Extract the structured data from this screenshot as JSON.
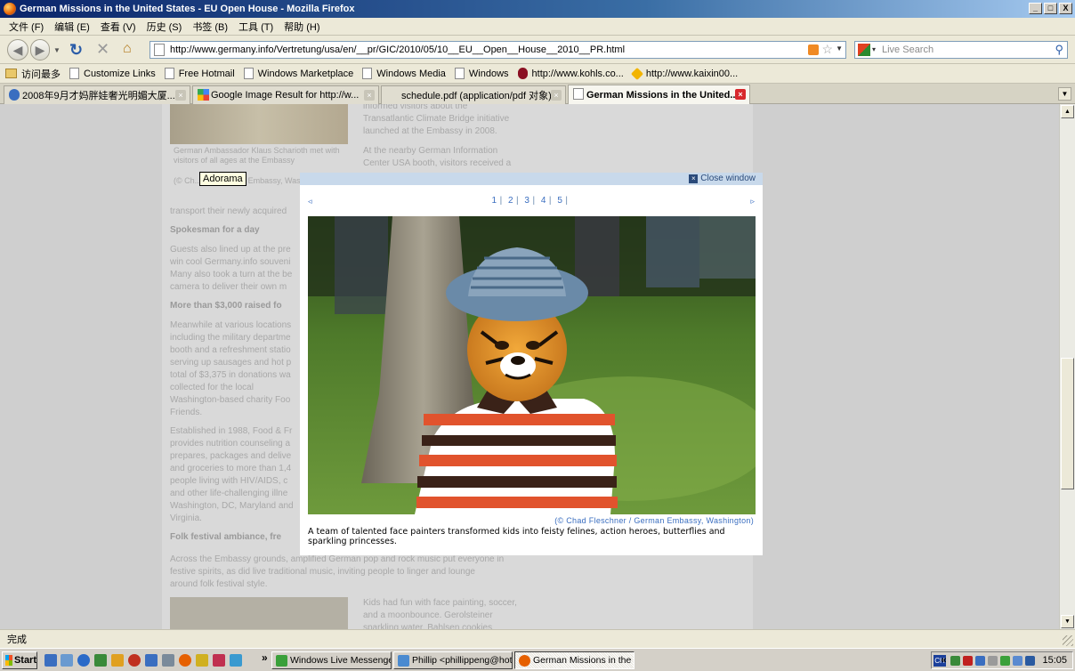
{
  "window": {
    "title": "German Missions in the United States - EU Open House - Mozilla Firefox",
    "min": "_",
    "max": "□",
    "close": "X"
  },
  "menu": [
    "文件 (F)",
    "编辑 (E)",
    "查看 (V)",
    "历史 (S)",
    "书签 (B)",
    "工具 (T)",
    "帮助 (H)"
  ],
  "nav": {
    "url": "http://www.germany.info/Vertretung/usa/en/__pr/GIC/2010/05/10__EU__Open__House__2010__PR.html",
    "search_placeholder": "Live Search"
  },
  "bookmarks": [
    "访问最多",
    "Customize Links",
    "Free Hotmail",
    "Windows Marketplace",
    "Windows Media",
    "Windows",
    "http://www.kohls.co...",
    "http://www.kaixin00..."
  ],
  "tabs": [
    "2008年9月才妈胖娃奢光明媚大厦...",
    "Google Image Result for http://w...",
    "schedule.pdf (application/pdf 对象)",
    "German Missions in the United..."
  ],
  "background_page": {
    "img_caption": "German Ambassador Klaus Scharioth met with visitors of all ages at the Embassy",
    "img_credit": "(© Ch... / German ... Embassy, Washington)",
    "right_col": [
      "informed visitors about the",
      "Transatlantic Climate Bridge initiative",
      "launched at the Embassy in 2008.",
      "",
      "At the nearby German Information",
      "Center USA booth, visitors received a"
    ],
    "transport_line": "transport their newly acquired",
    "h1": "Spokesman for a day",
    "p1": [
      "Guests also lined up at the pre",
      "win cool Germany.info souveni",
      "Many also took a turn at the be",
      "camera to deliver their own m"
    ],
    "h2": "More than $3,000 raised fo",
    "p2": [
      "Meanwhile at various locations",
      "including the military departme",
      "booth and a refreshment statio",
      "serving up sausages and hot p",
      "total of $3,375 in donations wa",
      "collected for the local",
      "Washington-based charity Foo",
      "Friends."
    ],
    "p3": [
      "Established in 1988, Food & Fr",
      "provides nutrition counseling a",
      "prepares, packages and delive",
      "and groceries to more than 1,4",
      "people living with HIV/AIDS, c",
      "and other life-challenging illne",
      "Washington, DC, Maryland and",
      "Virginia."
    ],
    "h3": "Folk festival ambiance, fre",
    "p4": [
      "Across the Embassy grounds, amplified German pop and rock music put everyone in",
      "festive spirits, as did live traditional music, inviting people to linger and lounge",
      "around folk festival style."
    ],
    "p5": [
      "Kids had fun with face painting, soccer,",
      "and a moonbounce. Gerolsteiner",
      "sparkling water, Bahlsen cookies"
    ]
  },
  "tooltip": "Adorama",
  "lightbox": {
    "close_label": "Close window",
    "prev": "◃",
    "next": "▹",
    "pages": [
      "1",
      "2",
      "3",
      "4",
      "5"
    ],
    "credit": "(© Chad Fleschner / German Embassy, Washington)",
    "caption": "A team of talented face painters transformed kids into feisty felines, action heroes, butterflies and sparkling princesses."
  },
  "status": "完成",
  "taskbar": {
    "start": "Start",
    "chevron": "»",
    "tasks": [
      "Windows Live Messenger",
      "Phillip <phillippeng@hot...",
      "German Missions in the U..."
    ],
    "lang": "CH",
    "tray_chevron": "«",
    "clock": "15:05"
  }
}
